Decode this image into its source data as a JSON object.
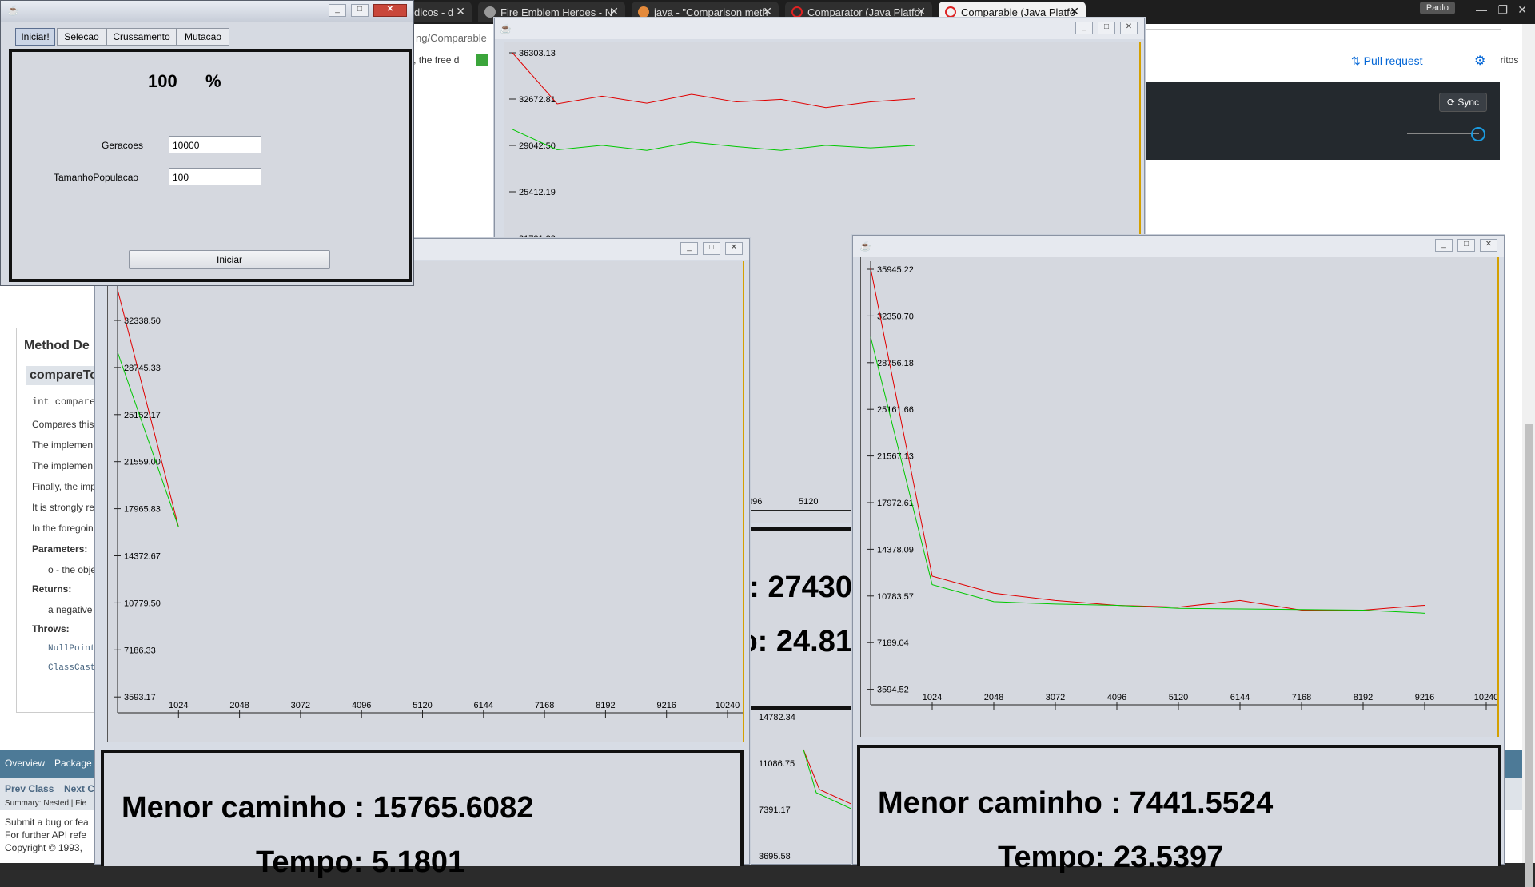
{
  "browser": {
    "tabs": [
      {
        "label": "dicos - d",
        "active": false
      },
      {
        "label": "Fire Emblem Heroes - N",
        "active": false
      },
      {
        "label": "java - \"Comparison meth",
        "active": false
      },
      {
        "label": "Comparator (Java Platfor",
        "active": false
      },
      {
        "label": "Comparable (Java Platfo",
        "active": true
      }
    ],
    "user": "Paulo",
    "address_fragment": "ng/Comparable",
    "side_fragment": "oritos"
  },
  "javadoc": {
    "snippet": "y, the free d",
    "section_title": "Method De",
    "method_name": "compareTo",
    "signature": "int compare",
    "lines": [
      "Compares this",
      "The implemen",
      "The implemen",
      "Finally, the imp",
      "It is strongly re",
      "In the foregoin"
    ],
    "params_label": "Parameters:",
    "param_value": "o - the obje",
    "returns_label": "Returns:",
    "returns_value": "a negative",
    "throws_label": "Throws:",
    "throws": [
      "NullPointe",
      "ClassCast"
    ],
    "nav": [
      "Overview",
      "Package"
    ],
    "subnav": [
      "Prev Class",
      "Next C"
    ],
    "summary": "Summary: Nested | Fie",
    "footer": [
      "Submit a bug or fea",
      "For further API refe",
      "Copyright © 1993,"
    ]
  },
  "github": {
    "pull_request": "Pull request",
    "sync": "Sync"
  },
  "control": {
    "tabs": [
      "Iniciar!",
      "Selecao",
      "Crussamento",
      "Mutacao"
    ],
    "progress_value": "100",
    "progress_unit": "%",
    "geracoes_label": "Geracoes",
    "geracoes_value": "10000",
    "tamanho_label": "TamanhoPopulacao",
    "tamanho_value": "100",
    "iniciar_button": "Iniciar"
  },
  "frames": {
    "back": {
      "y_ticks": [
        "36303.13",
        "32672.81",
        "29042.50",
        "25412.19",
        "21781.88"
      ],
      "x_ticks": [
        "096",
        "5120"
      ],
      "result_line1": ": 27430",
      "result_line2": "o: 24.81",
      "lower_y_ticks": [
        "14782.34",
        "11086.75",
        "7391.17",
        "3695.58"
      ]
    },
    "left": {
      "y_ticks": [
        "32338.50",
        "28745.33",
        "25152.17",
        "21559.00",
        "17965.83",
        "14372.67",
        "10779.50",
        "7186.33",
        "3593.17"
      ],
      "x_ticks": [
        "1024",
        "2048",
        "3072",
        "4096",
        "5120",
        "6144",
        "7168",
        "8192",
        "9216",
        "10240"
      ],
      "result_line1": "Menor caminho : 15765.6082",
      "result_line2": "Tempo: 5.1801"
    },
    "right": {
      "y_ticks": [
        "35945.22",
        "32350.70",
        "28756.18",
        "25161.66",
        "21567.13",
        "17972.61",
        "14378.09",
        "10783.57",
        "7189.04",
        "3594.52"
      ],
      "x_ticks": [
        "1024",
        "2048",
        "3072",
        "4096",
        "5120",
        "6144",
        "7168",
        "8192",
        "9216",
        "10240"
      ],
      "result_line1": "Menor caminho : 7441.5524",
      "result_line2": "Tempo: 23.5397"
    }
  },
  "chart_data": [
    {
      "type": "line",
      "x": [
        0,
        1024,
        2048,
        3072,
        4096,
        5120,
        6144,
        7168,
        8192,
        9216
      ],
      "series": [
        {
          "color": "#e00000",
          "values": [
            36303,
            32300,
            32900,
            32350,
            33050,
            32450,
            32650,
            32000,
            32450,
            32700
          ]
        },
        {
          "color": "#00c800",
          "values": [
            30300,
            28700,
            29050,
            28650,
            29300,
            28950,
            28650,
            29050,
            28850,
            29050
          ]
        }
      ]
    },
    {
      "type": "line",
      "x": [
        0,
        1024,
        2048,
        3072,
        4096,
        5120,
        6144,
        7168,
        8192,
        9216
      ],
      "series": [
        {
          "color": "#e00000",
          "values": [
            35900,
            15765,
            15765,
            15765,
            15765,
            15765,
            15765,
            15765,
            15765,
            15765
          ]
        },
        {
          "color": "#00c800",
          "values": [
            30600,
            15765,
            15765,
            15765,
            15765,
            15765,
            15765,
            15765,
            15765,
            15765
          ]
        }
      ],
      "ylim": [
        0,
        35932
      ]
    },
    {
      "type": "line",
      "x": [
        0,
        1024,
        2048,
        3072,
        4096,
        5120,
        6144,
        7168,
        8192,
        9216
      ],
      "series": [
        {
          "color": "#e00000",
          "values": [
            35945,
            10600,
            9200,
            8600,
            8200,
            8050,
            8600,
            7800,
            7800,
            8200
          ]
        },
        {
          "color": "#00c800",
          "values": [
            30300,
            9900,
            8500,
            8300,
            8200,
            7950,
            7900,
            7850,
            7800,
            7550
          ]
        }
      ],
      "ylim": [
        0,
        35945
      ]
    }
  ]
}
